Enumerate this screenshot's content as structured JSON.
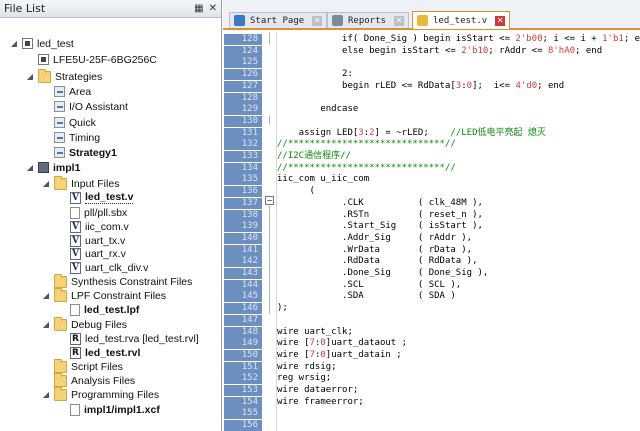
{
  "file_list": {
    "title": "File List",
    "float_icon": "float-icon",
    "close_icon": "close-icon",
    "nodes": [
      {
        "label": "led_test",
        "icon": "chip",
        "expander": "minus"
      },
      {
        "label": "LFE5U-25F-6BG256C",
        "icon": "chip",
        "expander": ""
      },
      {
        "label": "Strategies",
        "icon": "folder",
        "expander": "minus"
      },
      {
        "label": "Area",
        "icon": "strat",
        "expander": ""
      },
      {
        "label": "I/O Assistant",
        "icon": "strat",
        "expander": ""
      },
      {
        "label": "Quick",
        "icon": "strat",
        "expander": ""
      },
      {
        "label": "Timing",
        "icon": "strat",
        "expander": ""
      },
      {
        "label": "Strategy1",
        "icon": "strat",
        "expander": ""
      },
      {
        "label": "impl1",
        "icon": "impl",
        "expander": "minus"
      },
      {
        "label": "Input Files",
        "icon": "folder",
        "expander": "minus"
      },
      {
        "label": "led_test.v",
        "icon": "vfile",
        "expander": ""
      },
      {
        "label": "pll/pll.sbx",
        "icon": "file",
        "expander": ""
      },
      {
        "label": "iic_com.v",
        "icon": "vfile",
        "expander": ""
      },
      {
        "label": "uart_tx.v",
        "icon": "vfile",
        "expander": ""
      },
      {
        "label": "uart_rx.v",
        "icon": "vfile",
        "expander": ""
      },
      {
        "label": "uart_clk_div.v",
        "icon": "vfile",
        "expander": ""
      },
      {
        "label": "Synthesis Constraint Files",
        "icon": "folder",
        "expander": ""
      },
      {
        "label": "LPF Constraint Files",
        "icon": "folder",
        "expander": "minus"
      },
      {
        "label": "led_test.lpf",
        "icon": "file",
        "expander": ""
      },
      {
        "label": "Debug Files",
        "icon": "folder",
        "expander": "minus"
      },
      {
        "label": "led_test.rva [led_test.rvl]",
        "icon": "rfile",
        "expander": ""
      },
      {
        "label": "led_test.rvl",
        "icon": "rfile",
        "expander": ""
      },
      {
        "label": "Script Files",
        "icon": "folder",
        "expander": ""
      },
      {
        "label": "Analysis Files",
        "icon": "folder",
        "expander": ""
      },
      {
        "label": "Programming Files",
        "icon": "folder",
        "expander": "minus"
      },
      {
        "label": "impl1/impl1.xcf",
        "icon": "file",
        "expander": ""
      }
    ]
  },
  "tabs": [
    {
      "label": "Start Page",
      "icon_color": "#3a78c8",
      "icon": "start-page-icon",
      "active": false
    },
    {
      "label": "Reports",
      "icon_color": "#7d8a99",
      "icon": "reports-icon",
      "active": false
    },
    {
      "label": "led_test.v",
      "icon_color": "#e8b93a",
      "icon": "verilog-file-icon",
      "active": true
    }
  ],
  "editor": {
    "line_numbers": [
      "128",
      "124",
      "125",
      "126",
      "127",
      "128",
      "129",
      "130",
      "131",
      "132",
      "133",
      "134",
      "135",
      "136",
      "137",
      "138",
      "139",
      "140",
      "141",
      "142",
      "143",
      "144",
      "145",
      "146",
      "147",
      "148",
      "149",
      "150",
      "151",
      "152",
      "153",
      "154",
      "155",
      "156"
    ],
    "lines": [
      [
        {
          "t": "            if( Done_Sig ) begin isStart <= "
        },
        {
          "t": "2'b00",
          "c": "n"
        },
        {
          "t": "; i <= i + "
        },
        {
          "t": "1'b1",
          "c": "n"
        },
        {
          "t": "; end"
        }
      ],
      [
        {
          "t": "            else begin isStart <= "
        },
        {
          "t": "2'b10",
          "c": "n"
        },
        {
          "t": "; rAddr <= "
        },
        {
          "t": "8'hA0",
          "c": "n"
        },
        {
          "t": "; end"
        }
      ],
      [
        {
          "t": ""
        }
      ],
      [
        {
          "t": "            2:"
        }
      ],
      [
        {
          "t": "            begin rLED <= RdData["
        },
        {
          "t": "3",
          "c": "n"
        },
        {
          "t": ":"
        },
        {
          "t": "0",
          "c": "n"
        },
        {
          "t": "];  i<= "
        },
        {
          "t": "4'd0",
          "c": "n"
        },
        {
          "t": "; end"
        }
      ],
      [
        {
          "t": ""
        }
      ],
      [
        {
          "t": "        endcase"
        }
      ],
      [
        {
          "t": ""
        }
      ],
      [
        {
          "t": "    assign LED["
        },
        {
          "t": "3",
          "c": "n"
        },
        {
          "t": ":"
        },
        {
          "t": "2",
          "c": "n"
        },
        {
          "t": "] = ~rLED;    "
        },
        {
          "t": "//LED低电平亮起 熄灭",
          "c": "cm"
        }
      ],
      [
        {
          "t": "//*****************************//",
          "c": "cm"
        }
      ],
      [
        {
          "t": "//I2C通信程序//",
          "c": "cm"
        }
      ],
      [
        {
          "t": "//*****************************//",
          "c": "cm"
        }
      ],
      [
        {
          "t": "iic_com u_iic_com"
        }
      ],
      [
        {
          "t": "      ("
        }
      ],
      [
        {
          "t": "            .CLK          ( clk_48M ),"
        }
      ],
      [
        {
          "t": "            .RSTn         ( reset_n ),"
        }
      ],
      [
        {
          "t": "            .Start_Sig    ( isStart ),"
        }
      ],
      [
        {
          "t": "            .Addr_Sig     ( rAddr ),"
        }
      ],
      [
        {
          "t": "            .WrData       ( rData ),"
        }
      ],
      [
        {
          "t": "            .RdData       ( RdData ),"
        }
      ],
      [
        {
          "t": "            .Done_Sig     ( Done_Sig ),"
        }
      ],
      [
        {
          "t": "            .SCL          ( SCL ),"
        }
      ],
      [
        {
          "t": "            .SDA          ( SDA )"
        }
      ],
      [
        {
          "t": ");"
        }
      ],
      [
        {
          "t": ""
        }
      ],
      [
        {
          "t": "wire uart_clk;"
        }
      ],
      [
        {
          "t": "wire ["
        },
        {
          "t": "7",
          "c": "n"
        },
        {
          "t": ":"
        },
        {
          "t": "0",
          "c": "n"
        },
        {
          "t": "]uart_dataout ;"
        }
      ],
      [
        {
          "t": "wire ["
        },
        {
          "t": "7",
          "c": "n"
        },
        {
          "t": ":"
        },
        {
          "t": "0",
          "c": "n"
        },
        {
          "t": "]uart_datain ;"
        }
      ],
      [
        {
          "t": "wire rdsig;"
        }
      ],
      [
        {
          "t": "reg wrsig;"
        }
      ],
      [
        {
          "t": "wire dataerror;"
        }
      ],
      [
        {
          "t": "wire frameerror;"
        }
      ],
      [
        {
          "t": ""
        }
      ],
      [
        {
          "t": ""
        }
      ]
    ]
  }
}
